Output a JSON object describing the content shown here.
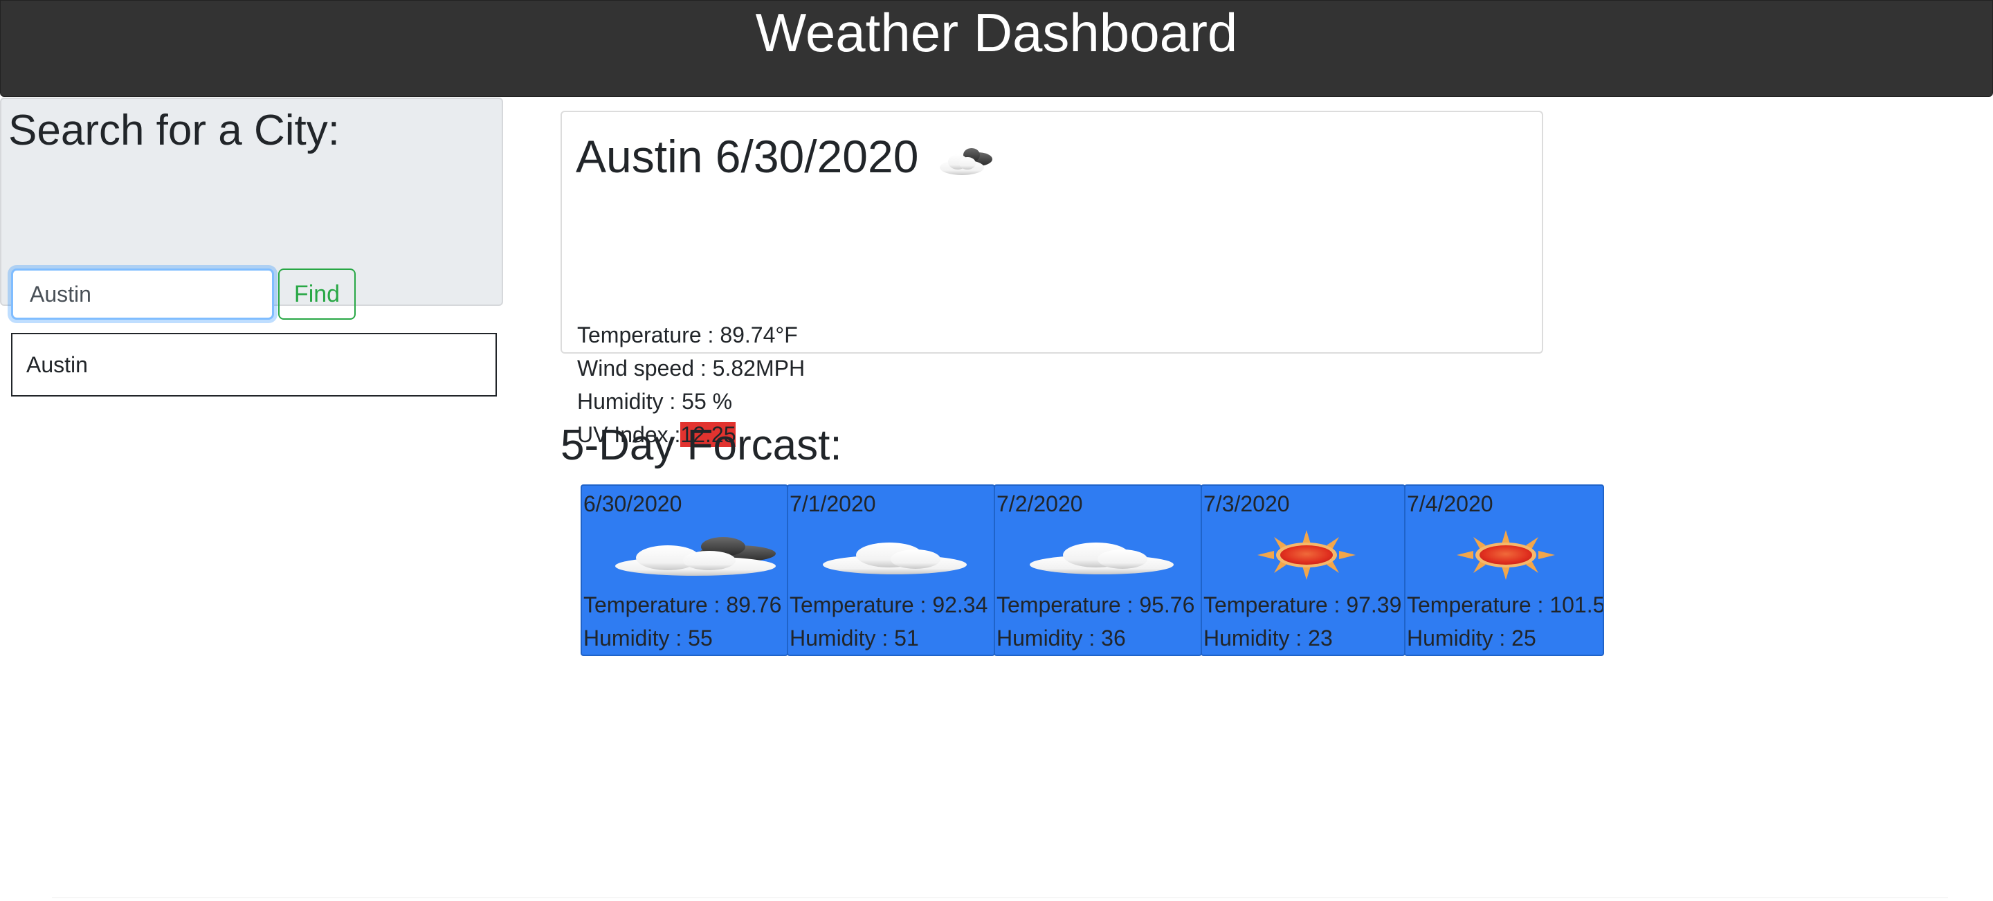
{
  "header": {
    "title": "Weather Dashboard"
  },
  "sidebar": {
    "heading": "Search for a City:",
    "search_value": "Austin",
    "find_label": "Find",
    "history": [
      "Austin"
    ]
  },
  "current": {
    "city": "Austin",
    "date": "6/30/2020",
    "icon": "cloud-sun-icon",
    "temperature_label": "Temperature : ",
    "temperature": "89.74°F",
    "wind_label": "Wind speed : ",
    "wind": "5.82MPH",
    "humidity_label": "Humidity : ",
    "humidity": "55 %",
    "uv_label": "UV Index :",
    "uv": "12.25",
    "uv_color": "#e2332f"
  },
  "forecast": {
    "title": "5-Day Forcast:",
    "card_color": "#2f7cf2",
    "days": [
      {
        "date": "6/30/2020",
        "icon": "broken-clouds-icon",
        "temperature": "Temperature : 89.76",
        "humidity": "Humidity : 55"
      },
      {
        "date": "7/1/2020",
        "icon": "cloud-icon",
        "temperature": "Temperature : 92.34",
        "humidity": "Humidity : 51"
      },
      {
        "date": "7/2/2020",
        "icon": "cloud-icon",
        "temperature": "Temperature : 95.76",
        "humidity": "Humidity : 36"
      },
      {
        "date": "7/3/2020",
        "icon": "sun-icon",
        "temperature": "Temperature : 97.39",
        "humidity": "Humidity : 23"
      },
      {
        "date": "7/4/2020",
        "icon": "sun-icon",
        "temperature": "Temperature : 101.5",
        "humidity": "Humidity : 25"
      }
    ]
  }
}
